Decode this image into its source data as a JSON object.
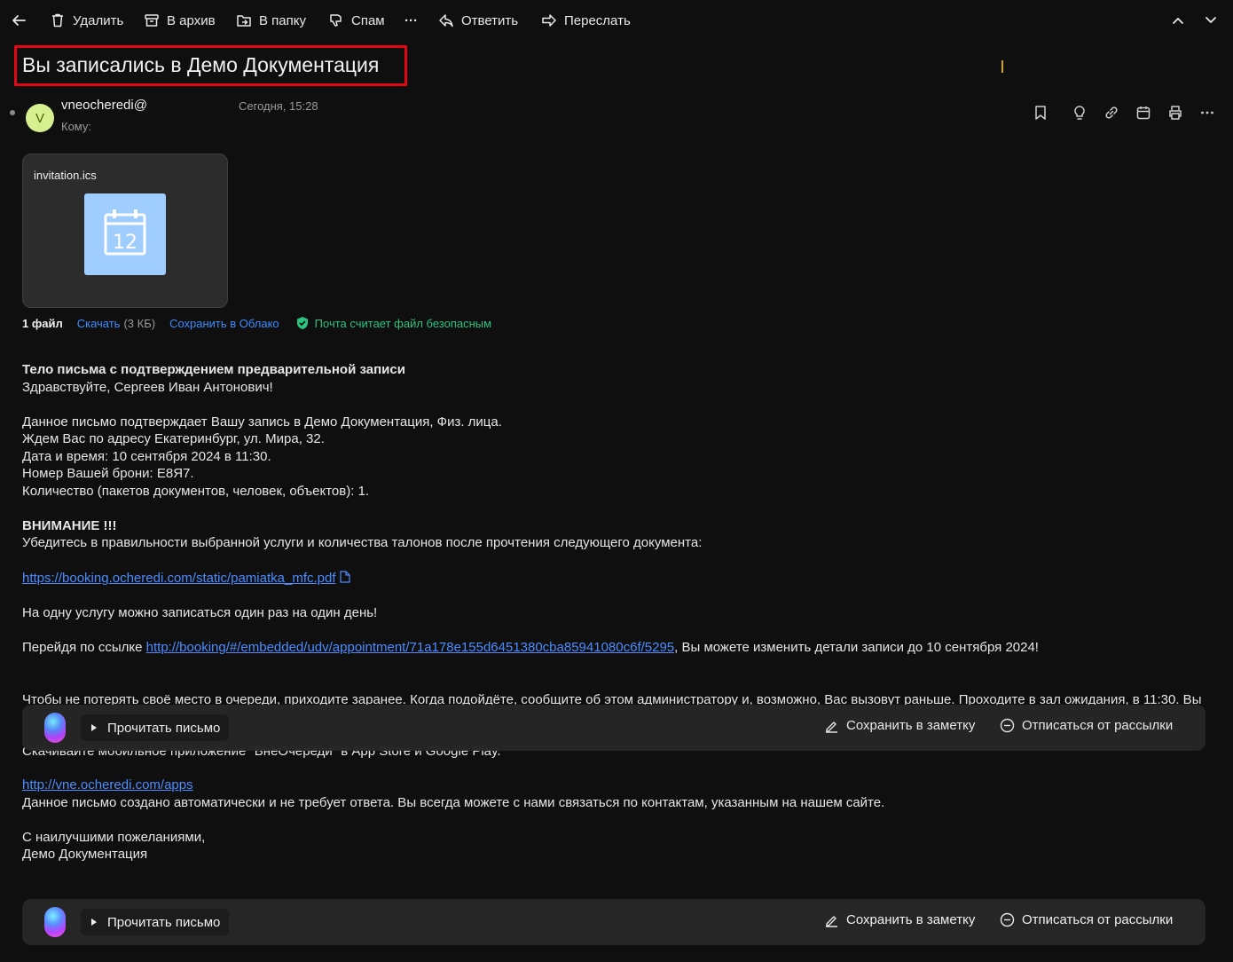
{
  "toolbar": {
    "back_icon": "arrow-left-icon",
    "delete_label": "Удалить",
    "archive_label": "В архив",
    "move_label": "В папку",
    "spam_label": "Спам",
    "more_label": "···",
    "reply_label": "Ответить",
    "forward_label": "Переслать",
    "prev_icon": "chevron-up-icon",
    "next_icon": "chevron-down-icon",
    "close_icon": "close-icon"
  },
  "message": {
    "subject": "Вы записались в Демо Документация",
    "sender_initial": "V",
    "sender": "vneocheredi@",
    "date": "Сегодня, 15:28",
    "to_label": "Кому:"
  },
  "actions": [
    "bookmark-icon",
    "lightbulb-icon",
    "link-icon",
    "calendar-icon",
    "print-icon",
    "more-icon"
  ],
  "attachment": {
    "file_name": "invitation.ics",
    "calendar_day": "12",
    "count_label": "1 файл",
    "download_label": "Скачать",
    "size": "(3 КБ)",
    "save_cloud_label": "Сохранить в Облако",
    "safe_label": "Почта считает файл безопасным"
  },
  "body": {
    "heading": "Тело письма с подтверждением предварительной записи",
    "greeting": "Здравствуйте, Сергеев Иван Антонович!",
    "line1": "Данное письмо подтверждает Вашу запись в Демо Документация, Физ. лица.",
    "line2": "Ждем Вас по адресу Екатеринбург, ул. Мира, 32.",
    "line3": "Дата и время: 10 сентября 2024 в 11:30.",
    "line4": "Номер Вашей брони: Е8Я7.",
    "line5": "Количество (пакетов документов, человек, объектов): 1.",
    "attention": "ВНИМАНИЕ !!!",
    "attention_text": "Убедитесь в правильности выбранной услуги и количества талонов после прочтения следующего документа:",
    "pdf_link": "https://booking.ocheredi.com/static/pamiatka_mfc.pdf",
    "once_per_day": "На одну услугу можно записаться один раз на один день!",
    "change_prefix": "Перейдя по ссылке ",
    "change_link": "http://booking/#/embedded/udv/appointment/71a178e155d6451380cba85941080c6f/5295",
    "change_suffix": ", Вы можете изменить детали записи до 10 сентября 2024!",
    "queue_text": "Чтобы не потерять своё место в очереди, приходите заранее. Когда подойдёте, сообщите об этом администратору и, возможно, Вас вызовут раньше. Проходите в зал ожидания, в 11:30. Вы",
    "app_text": "Скачивайте мобильное приложение \"ВнеОчереди\" в App Store и Google Play.",
    "apps_link": "http://vne.ocheredi.com/apps",
    "auto_text": "Данное письмо создано автоматически и не требует ответа. Вы всегда можете с нами связаться по контактам, указанным на нашем сайте.",
    "regards": "С наилучшими пожеланиями,",
    "signature": "Демо Документация"
  },
  "ai_bar": {
    "read_label": "Прочитать письмо",
    "note_label": "Сохранить в заметку",
    "unsubscribe_label": "Отписаться от рассылки"
  },
  "colors": {
    "background": "#0f0f0f",
    "link": "#4d8cff",
    "safe": "#2ec27e",
    "highlight_border": "#e30613",
    "avatar": "#d6ef8f",
    "calendar_tile": "#9fcdfd"
  }
}
